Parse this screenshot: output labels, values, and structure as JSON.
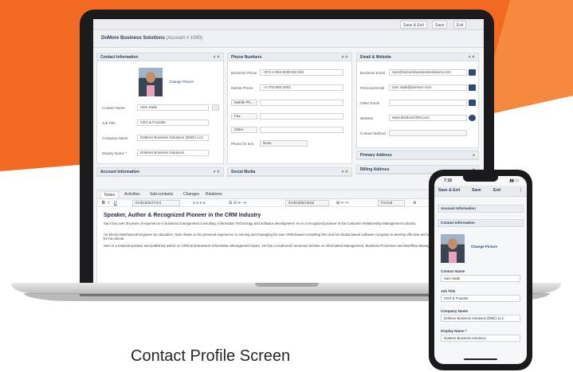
{
  "caption": "Contact Profile Screen",
  "colors": {
    "brand_orange": "#f26a21",
    "laptop": "#1b1b1d",
    "panel_header": "#e9edf2",
    "accent_navy": "#2f4a73"
  },
  "toolbar": {
    "save_exit": "Save & Exit",
    "save": "Save",
    "exit": "Exit"
  },
  "record": {
    "title": "DoMore Business Solutions",
    "subtitle": "(Account # 1080)"
  },
  "contact_info": {
    "header": "Contact Information",
    "change_picture": "Change Picture",
    "contact_name_label": "Contact Name",
    "contact_name": "Sam Saab",
    "job_title_label": "Job Title",
    "job_title": "CEO & Founder",
    "company_name_label": "Company Name",
    "company_name": "DoMore Business Solutions (DMC) LLC",
    "display_name_label": "Display Name *",
    "display_name": "DoMore Business Solutions"
  },
  "phone_numbers": {
    "header": "Phone Numbers",
    "business_phone_label": "Business Phone",
    "business_phone": "+971-4-554-8180 Ext 510",
    "mobile_phone_label": "Mobile Phone",
    "mobile_phone": "+1-703-682-2003",
    "type_mobile": "Mobile Ph...",
    "type_fax": "Fax",
    "type_other": "Other",
    "phone_for_text_label": "Phone for text",
    "phone_for_text": "None"
  },
  "email_website": {
    "header": "Email & Website",
    "business_email_label": "Business Email",
    "business_email": "sam@domorebusinesssolutions.com",
    "personal_email_label": "Personal Email",
    "personal_email": "sam.saab@domore.com",
    "other_email_label": "Other Email",
    "website_label": "Website",
    "website": "www.DoMoreCRM.com",
    "contact_method_label": "Contact Method"
  },
  "collapsed": {
    "account_information": "Account Information",
    "social_media": "Social Media",
    "primary_address": "Primary Address",
    "billing_address": "Billing Address"
  },
  "tabs": [
    "Notes",
    "Activities",
    "Sub-contacts",
    "Changes",
    "Relations"
  ],
  "editor": {
    "font": "Embedded Font",
    "style": "Embedded Bold",
    "format": "Format"
  },
  "notes": {
    "heading": "Speaker, Author & Recognized Pioneer in the CRM Industry",
    "p1": "Sam has over 30 years of experience in business management consulting, Information Technology and software development. He is a recognized pioneer in the Customer Relationship Management industry.",
    "p2": "An Electro-Mechanical Engineer by education, Sam draws on his personal experience in running and managing his own CRM-based consulting firm and his Global based software company to develop effective and efficient applicable solutions for his clients.",
    "p3": "Sam is a national speaker and published author on CRM and Business Information Management topics. He has co-authored numerous articles on Information Management, Business Processes and Workflow Management."
  },
  "mobile": {
    "time": "7:16",
    "save_exit": "Save & Exit",
    "save": "Save",
    "exit": "Exit",
    "account_information": "Account Information",
    "contact_information": "Contact Information",
    "change_picture": "Change Picture",
    "contact_name_label": "Contact Name",
    "contact_name": "Sam Saab",
    "job_title_label": "Job Title",
    "job_title": "CEO & Founder",
    "company_name_label": "Company Name",
    "company_name": "DoMore Business Solutions (DMC) LLC",
    "display_name_label": "Display Name *",
    "display_name": "DoMore Business Solutions"
  }
}
